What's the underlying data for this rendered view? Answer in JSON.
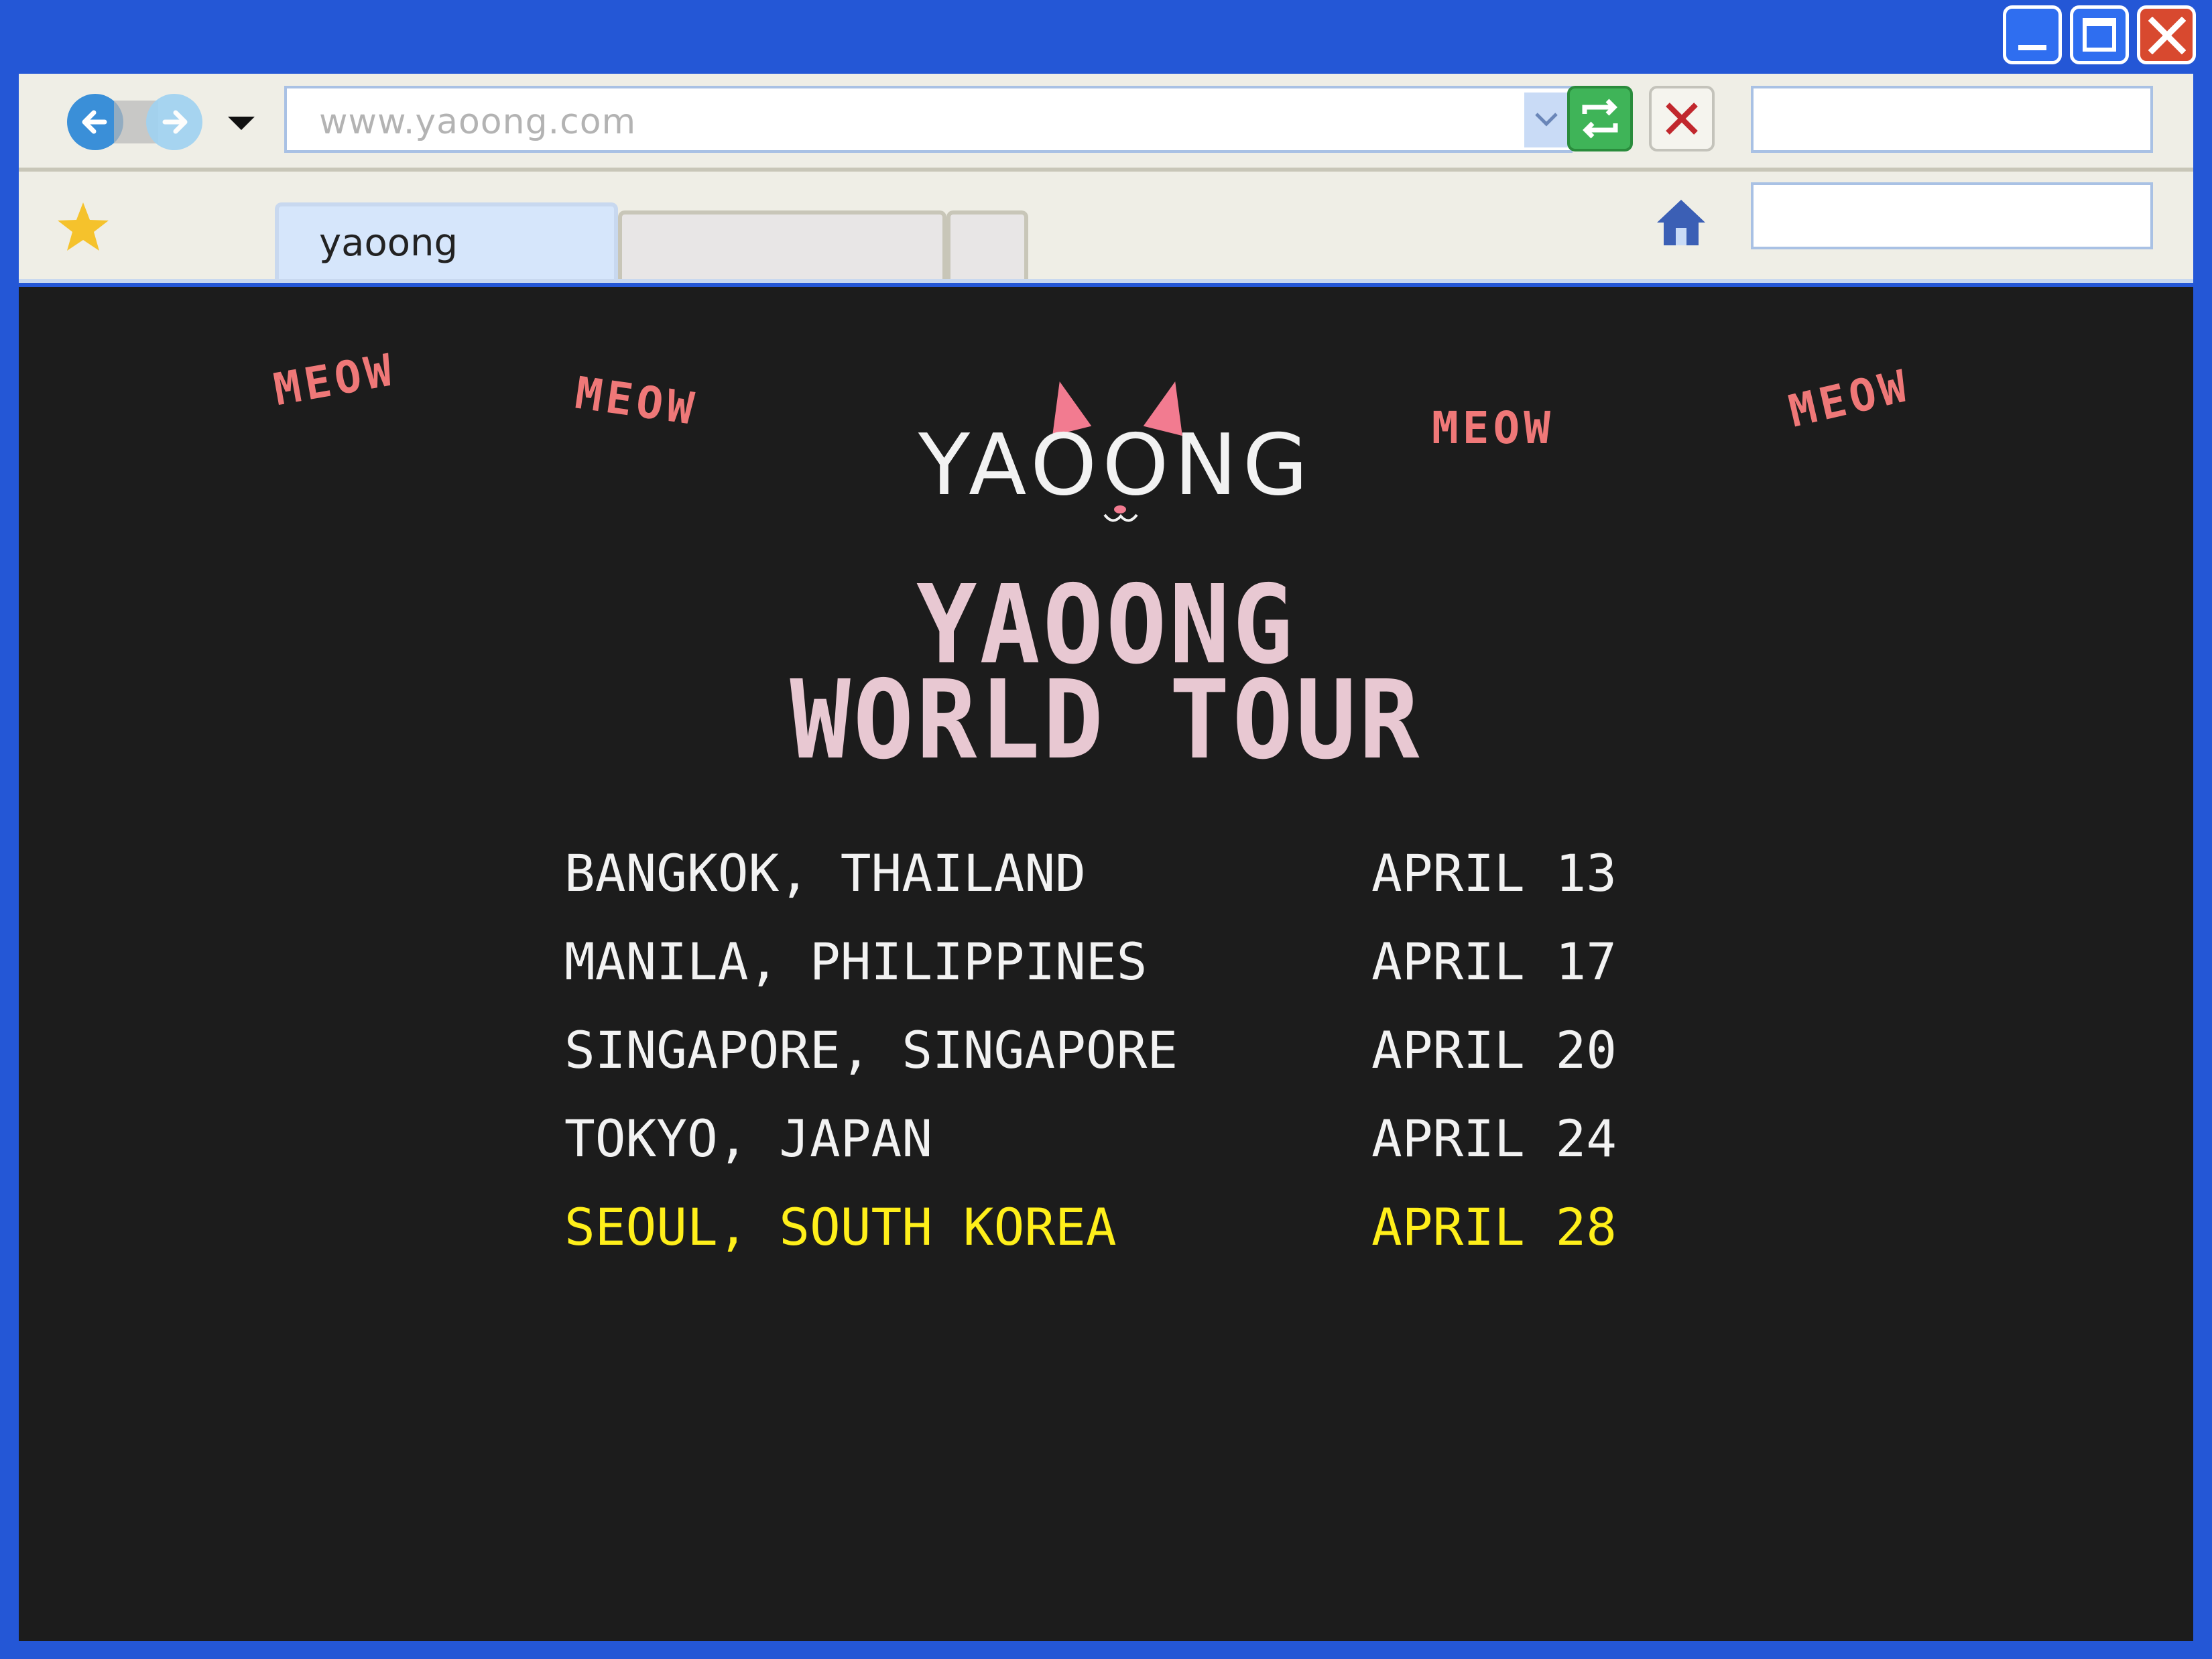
{
  "browser": {
    "address": "www.yaoong.com",
    "tabs": [
      {
        "label": "yaoong",
        "active": true
      },
      {
        "label": "",
        "active": false
      },
      {
        "label": "",
        "active": false
      }
    ],
    "icons": {
      "back": "back-arrow-icon",
      "forward": "forward-arrow-icon",
      "refresh": "refresh-icon",
      "stop": "close-x-icon",
      "bookmark": "star-icon",
      "home": "home-icon"
    }
  },
  "page": {
    "meow_labels": [
      "MEOW",
      "MEOW",
      "MEOW",
      "MEOW"
    ],
    "logo_text": "YAOONG",
    "title_line1": "YAOONG",
    "title_line2": "WORLD TOUR",
    "tour_dates": [
      {
        "city": "BANGKOK, THAILAND",
        "date": "APRIL 13"
      },
      {
        "city": "MANILA, PHILIPPINES",
        "date": "APRIL 17"
      },
      {
        "city": "SINGAPORE, SINGAPORE",
        "date": "APRIL 20"
      },
      {
        "city": "TOKYO, JAPAN",
        "date": "APRIL 24"
      },
      {
        "city": "SEOUL, SOUTH KOREA",
        "date": "APRIL 28"
      }
    ]
  },
  "colors": {
    "frame": "#2457d6",
    "page_bg": "#1c1c1c",
    "meow": "#ef7878",
    "title": "#e8c8d2",
    "highlight": "#ffef1a"
  }
}
